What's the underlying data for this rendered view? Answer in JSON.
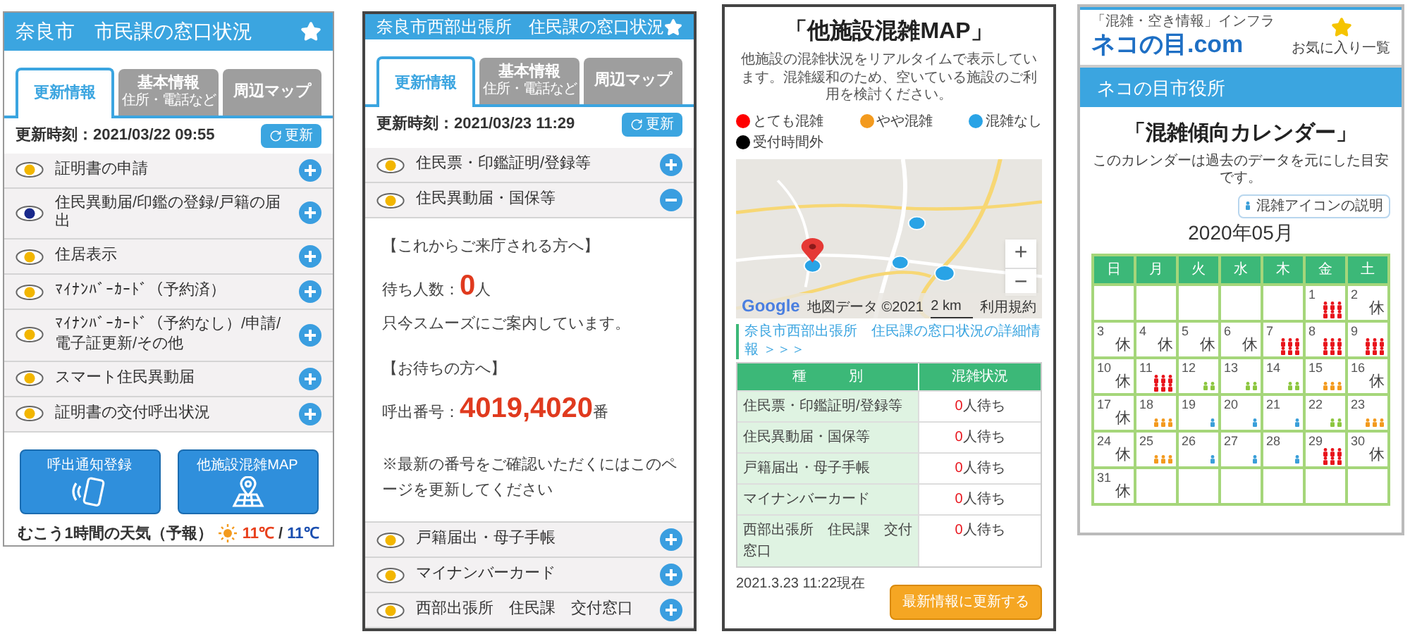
{
  "counter_status": {
    "title": "奈良市　市民課の窓口状況",
    "tabs": [
      {
        "label": "更新情報",
        "selected": true
      },
      {
        "label": "基本情報",
        "sublabel": "住所・電話など",
        "selected": false
      },
      {
        "label": "周辺マップ",
        "selected": false
      }
    ],
    "updated": "更新時刻：2021/03/22 09:55",
    "refresh_button": "更新",
    "items": [
      {
        "label": "証明書の申請",
        "color": "#f2b600",
        "expanded": false
      },
      {
        "label": "住民異動届/印鑑の登録/戸籍の届出",
        "color": "#1a2a8c",
        "expanded": false
      },
      {
        "label": "住居表示",
        "color": "#f2b600",
        "expanded": false
      },
      {
        "label": "ﾏｲﾅﾝﾊﾞｰｶｰﾄﾞ（予約済）",
        "color": "#f2b600",
        "expanded": false
      },
      {
        "label": "ﾏｲﾅﾝﾊﾞｰｶｰﾄﾞ（予約なし）/申請/電子証更新/その他",
        "color": "#f2b600",
        "expanded": false
      },
      {
        "label": "スマート住民異動届",
        "color": "#f2b600",
        "expanded": false
      },
      {
        "label": "証明書の交付呼出状況",
        "color": "#f2b600",
        "expanded": false
      }
    ],
    "buttons": [
      {
        "label": "呼出通知登録",
        "kind": "phone"
      },
      {
        "label": "他施設混雑MAP",
        "kind": "map"
      }
    ],
    "weather": {
      "label": "むこう1時間の天気（予報）",
      "high": "11℃",
      "separator": "/",
      "low": "11℃"
    }
  },
  "branch_status": {
    "title": "奈良市西部出張所　住民課の窓口状況",
    "tabs": [
      {
        "label": "更新情報",
        "selected": true
      },
      {
        "label": "基本情報",
        "sublabel": "住所・電話など",
        "selected": false
      },
      {
        "label": "周辺マップ",
        "selected": false
      }
    ],
    "updated": "更新時刻：2021/03/23 11:29",
    "refresh_button": "更新",
    "items": [
      {
        "label": "住民票・印鑑証明/登録等",
        "color": "#f2b600",
        "expanded": false
      },
      {
        "label": "住民異動届・国保等",
        "color": "#f2b600",
        "expanded": true,
        "detail": {
          "incoming_heading": "【これからご来庁される方へ】",
          "wait_label": "待ち人数：",
          "wait_count": "0",
          "wait_unit": "人",
          "wait_message": "只今スムーズにご案内しています。",
          "waiting_heading": "【お待ちの方へ】",
          "call_label": "呼出番号：",
          "call_numbers": "4019,4020",
          "call_unit": "番",
          "note": "※最新の番号をご確認いただくにはこのページを更新してください"
        }
      },
      {
        "label": "戸籍届出・母子手帳",
        "color": "#f2b600",
        "expanded": false
      },
      {
        "label": "マイナンバーカード",
        "color": "#f2b600",
        "expanded": false
      },
      {
        "label": "西部出張所　住民課　交付窓口",
        "color": "#f2b600",
        "expanded": false
      }
    ]
  },
  "facility_map": {
    "title": "「他施設混雑MAP」",
    "description": "他施設の混雑状況をリアルタイムで表示しています。混雑緩和のため、空いている施設のご利用を検討ください。",
    "legend": [
      {
        "label": "とても混雑",
        "color": "#ff0000"
      },
      {
        "label": "やや混雑",
        "color": "#f39a1e"
      },
      {
        "label": "混雑なし",
        "color": "#29a3e6"
      },
      {
        "label": "受付時間外",
        "color": "#000000"
      }
    ],
    "map": {
      "zoom_in": "+",
      "zoom_out": "−",
      "logo": "Google",
      "attribution": "地図データ ©2021",
      "scale": "2 km",
      "terms": "利用規約"
    },
    "detail_link": "奈良市西部出張所　住民課の窓口状況の詳細情報 ＞＞＞",
    "table": {
      "columns": [
        "種　　　別",
        "混雑状況"
      ],
      "rows": [
        {
          "name": "住民票・印鑑証明/登録等",
          "count": "0",
          "unit": "人待ち"
        },
        {
          "name": "住民異動届・国保等",
          "count": "0",
          "unit": "人待ち"
        },
        {
          "name": "戸籍届出・母子手帳",
          "count": "0",
          "unit": "人待ち"
        },
        {
          "name": "マイナンバーカード",
          "count": "0",
          "unit": "人待ち"
        },
        {
          "name": "西部出張所　住民課　交付窓口",
          "count": "0",
          "unit": "人待ち"
        }
      ]
    },
    "timestamp": "2021.3.23 11:22現在",
    "refresh_button": "最新情報に更新する"
  },
  "calendar": {
    "tagline": "「混雑・空き情報」インフラ",
    "logo": "ネコの目.com",
    "favorites": "お気に入り一覧",
    "office": "ネコの目市役所",
    "title": "「混雑傾向カレンダー」",
    "description": "このカレンダーは過去のデータを元にした目安です。",
    "legend_button": "混雑アイコンの説明",
    "month": "2020年05月",
    "weekdays": [
      "日",
      "月",
      "火",
      "水",
      "木",
      "金",
      "土"
    ],
    "weeks": [
      [
        {
          "kind": "blank"
        },
        {
          "kind": "blank"
        },
        {
          "kind": "blank"
        },
        {
          "kind": "blank"
        },
        {
          "kind": "blank"
        },
        {
          "day": "1",
          "kind": "very_crowded",
          "color": "#e8141c"
        },
        {
          "day": "2",
          "kind": "closed",
          "label": "休"
        }
      ],
      [
        {
          "day": "3",
          "kind": "closed",
          "label": "休"
        },
        {
          "day": "4",
          "kind": "closed",
          "label": "休"
        },
        {
          "day": "5",
          "kind": "closed",
          "label": "休"
        },
        {
          "day": "6",
          "kind": "closed",
          "label": "休"
        },
        {
          "day": "7",
          "kind": "very_crowded",
          "color": "#e8141c"
        },
        {
          "day": "8",
          "kind": "very_crowded",
          "color": "#e8141c"
        },
        {
          "day": "9",
          "kind": "very_crowded",
          "color": "#e8141c"
        }
      ],
      [
        {
          "day": "10",
          "kind": "closed",
          "label": "休"
        },
        {
          "day": "11",
          "kind": "very_crowded",
          "color": "#e8141c"
        },
        {
          "day": "12",
          "kind": "some",
          "color": "#8cc63f"
        },
        {
          "day": "13",
          "kind": "some",
          "color": "#8cc63f"
        },
        {
          "day": "14",
          "kind": "some",
          "color": "#8cc63f"
        },
        {
          "day": "15",
          "kind": "crowded",
          "color": "#f39a1e"
        },
        {
          "day": "16",
          "kind": "closed",
          "label": "休"
        }
      ],
      [
        {
          "day": "17",
          "kind": "closed",
          "label": "休"
        },
        {
          "day": "18",
          "kind": "crowded",
          "color": "#f39a1e"
        },
        {
          "day": "19",
          "kind": "few",
          "color": "#3a9fd9"
        },
        {
          "day": "20",
          "kind": "few",
          "color": "#3a9fd9"
        },
        {
          "day": "21",
          "kind": "few",
          "color": "#3a9fd9"
        },
        {
          "day": "22",
          "kind": "some",
          "color": "#8cc63f"
        },
        {
          "day": "23",
          "kind": "crowded",
          "color": "#f39a1e"
        }
      ],
      [
        {
          "day": "24",
          "kind": "closed",
          "label": "休"
        },
        {
          "day": "25",
          "kind": "crowded",
          "color": "#f39a1e"
        },
        {
          "day": "26",
          "kind": "few",
          "color": "#3a9fd9"
        },
        {
          "day": "27",
          "kind": "few",
          "color": "#3a9fd9"
        },
        {
          "day": "28",
          "kind": "few",
          "color": "#3a9fd9"
        },
        {
          "day": "29",
          "kind": "very_crowded",
          "color": "#e8141c"
        },
        {
          "day": "30",
          "kind": "closed",
          "label": "休"
        }
      ],
      [
        {
          "day": "31",
          "kind": "closed",
          "label": "休"
        },
        {
          "kind": "blank"
        },
        {
          "kind": "blank"
        },
        {
          "kind": "blank"
        },
        {
          "kind": "blank"
        },
        {
          "kind": "blank"
        },
        {
          "kind": "blank"
        }
      ]
    ]
  }
}
